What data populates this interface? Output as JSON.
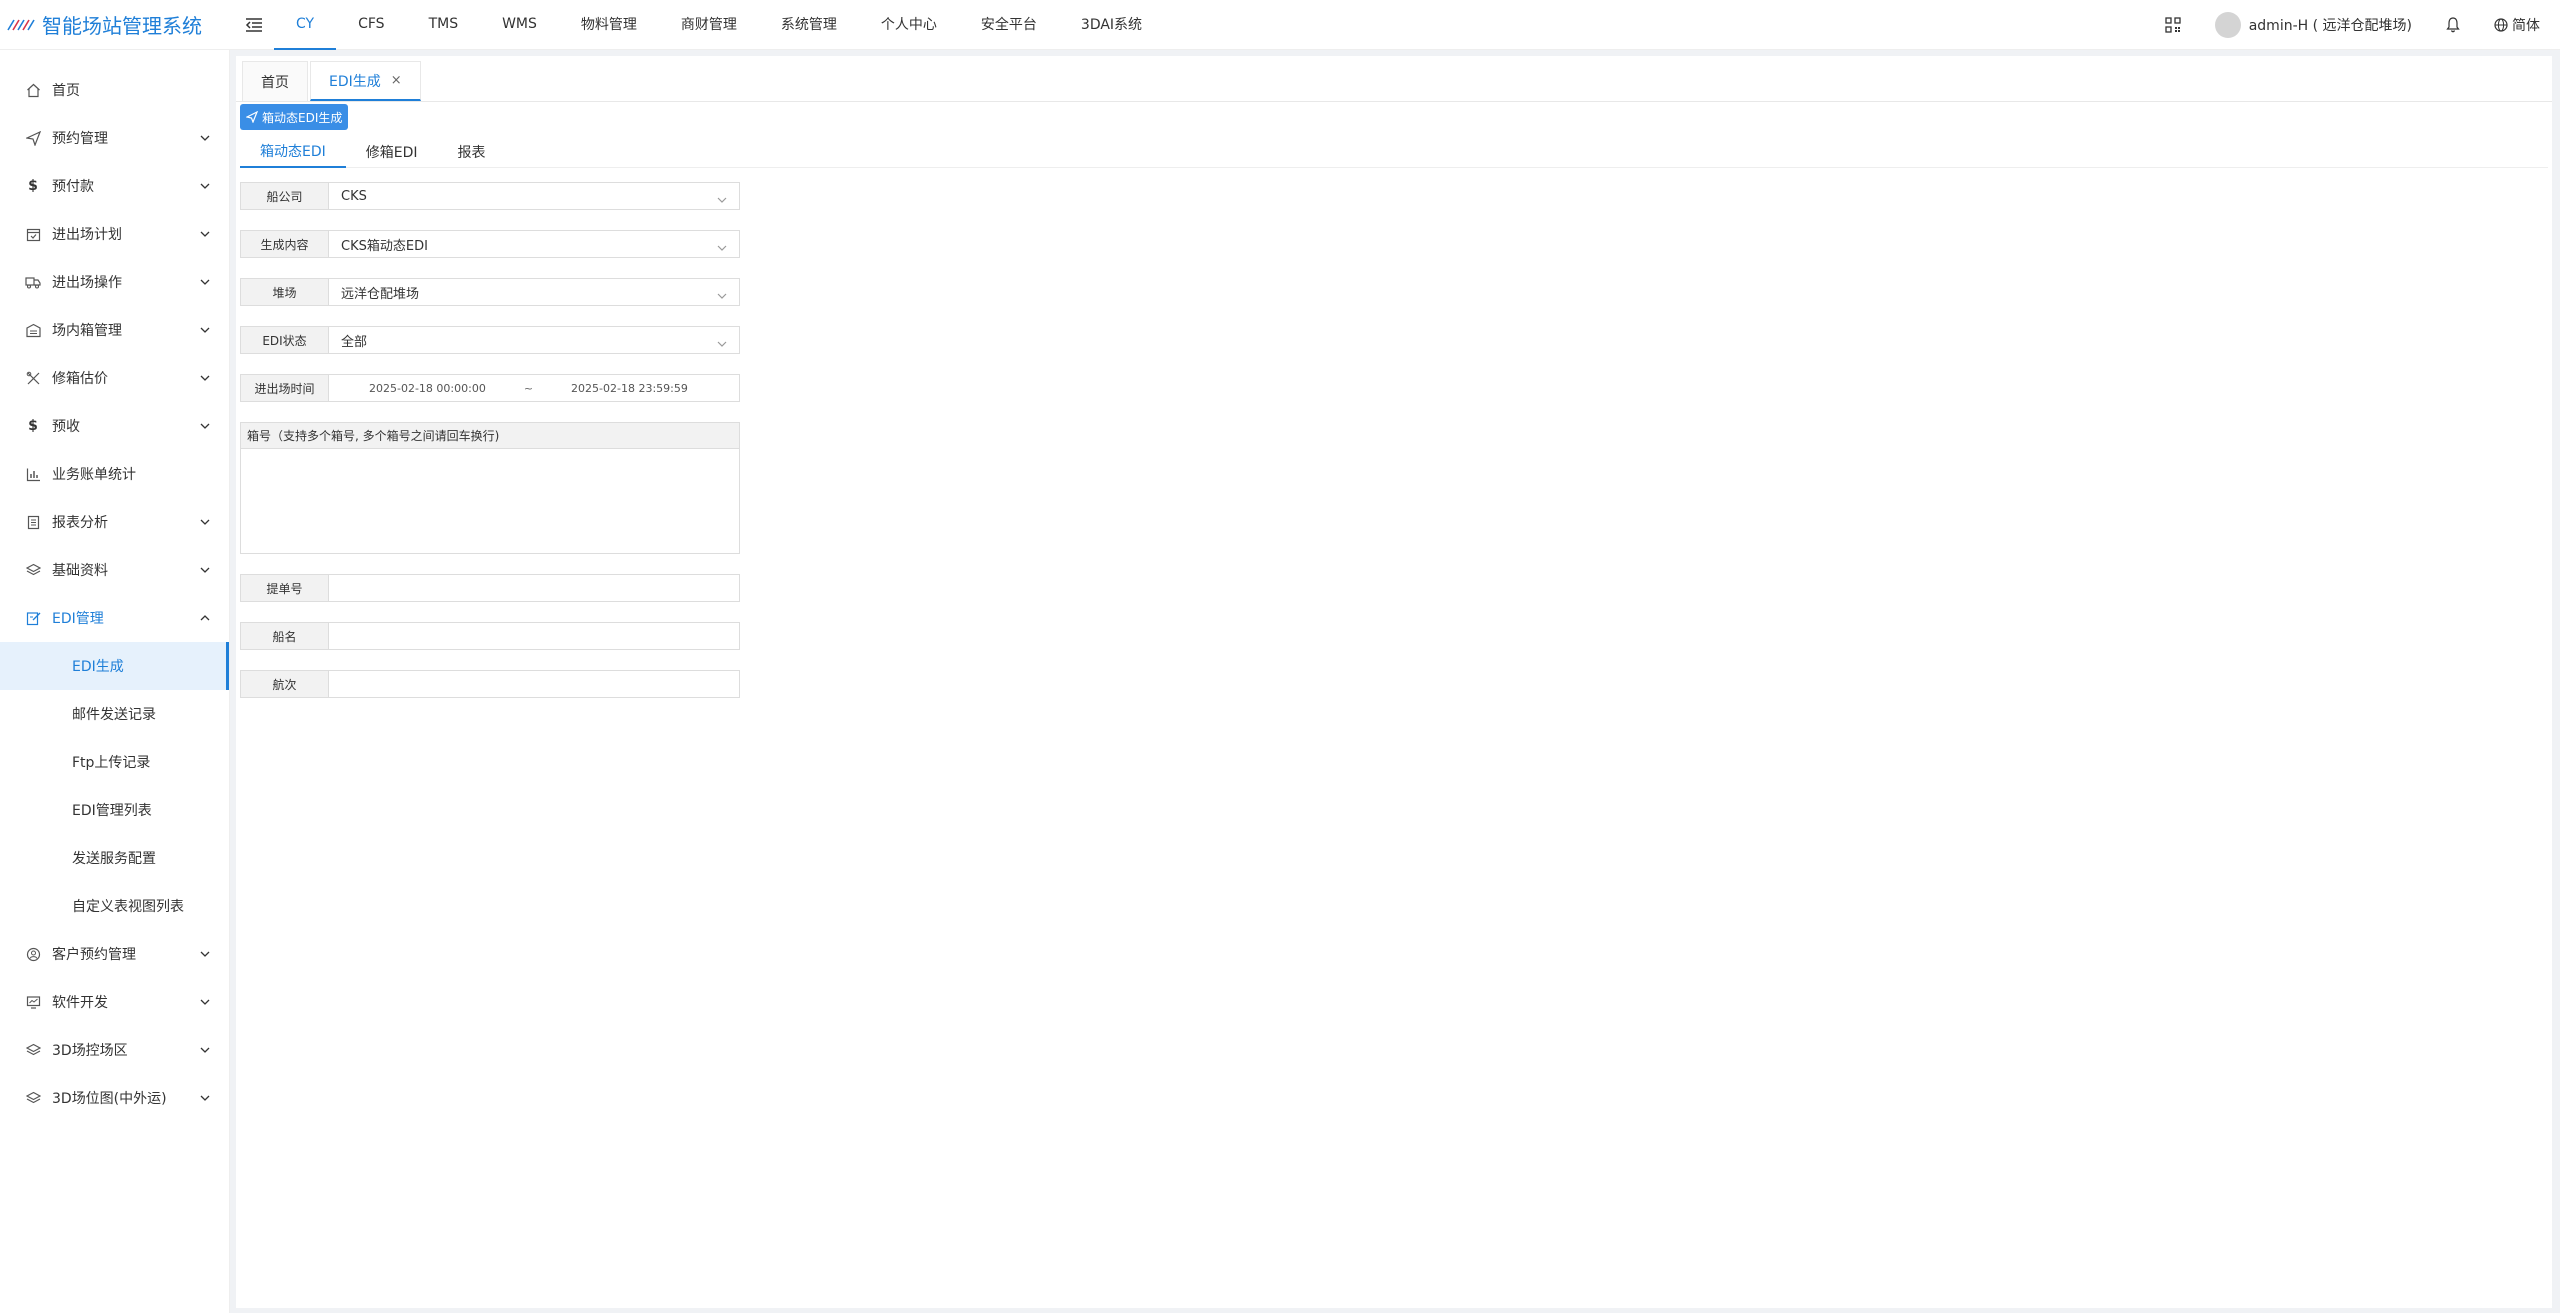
{
  "app": {
    "title": "智能场站管理系统"
  },
  "topnav": {
    "items": [
      {
        "label": "CY",
        "active": true
      },
      {
        "label": "CFS"
      },
      {
        "label": "TMS"
      },
      {
        "label": "WMS"
      },
      {
        "label": "物料管理"
      },
      {
        "label": "商财管理"
      },
      {
        "label": "系统管理"
      },
      {
        "label": "个人中心"
      },
      {
        "label": "安全平台"
      },
      {
        "label": "3DAI系统"
      }
    ]
  },
  "topright": {
    "user": "admin-H ( 远洋仓配堆场)",
    "language": "简体"
  },
  "sidebar": {
    "items": [
      {
        "label": "首页",
        "icon": "home-icon"
      },
      {
        "label": "预约管理",
        "icon": "send-icon",
        "expand": true
      },
      {
        "label": "预付款",
        "icon": "dollar-icon",
        "expand": true
      },
      {
        "label": "进出场计划",
        "icon": "calendar-icon",
        "expand": true
      },
      {
        "label": "进出场操作",
        "icon": "truck-icon",
        "expand": true
      },
      {
        "label": "场内箱管理",
        "icon": "warehouse-icon",
        "expand": true
      },
      {
        "label": "修箱估价",
        "icon": "tools-icon",
        "expand": true
      },
      {
        "label": "预收",
        "icon": "dollar-icon",
        "expand": true
      },
      {
        "label": "业务账单统计",
        "icon": "bar-chart-icon"
      },
      {
        "label": "报表分析",
        "icon": "report-icon",
        "expand": true
      },
      {
        "label": "基础资料",
        "icon": "layers-icon",
        "expand": true
      },
      {
        "label": "EDI管理",
        "icon": "edit-doc-icon",
        "open": true
      }
    ],
    "sub_items": [
      {
        "label": "EDI生成",
        "active": true
      },
      {
        "label": "邮件发送记录"
      },
      {
        "label": "Ftp上传记录"
      },
      {
        "label": "EDI管理列表"
      },
      {
        "label": "发送服务配置"
      },
      {
        "label": "自定义表视图列表"
      }
    ],
    "items_after": [
      {
        "label": "客户预约管理",
        "icon": "customer-icon"
      },
      {
        "label": "软件开发",
        "icon": "monitor-icon"
      },
      {
        "label": "3D场控场区",
        "icon": "layers-icon"
      },
      {
        "label": "3D场位图(中外运)",
        "icon": "layers-icon"
      }
    ]
  },
  "tabs": [
    {
      "label": "首页"
    },
    {
      "label": "EDI生成",
      "active": true,
      "closable": true
    }
  ],
  "action_button": "箱动态EDI生成",
  "sub_tabs": [
    {
      "label": "箱动态EDI",
      "active": true
    },
    {
      "label": "修箱EDI"
    },
    {
      "label": "报表"
    }
  ],
  "form": {
    "shipping_company": {
      "label": "船公司",
      "value": "CKS"
    },
    "content": {
      "label": "生成内容",
      "value": "CKS箱动态EDI"
    },
    "yard": {
      "label": "堆场",
      "value": "远洋仓配堆场"
    },
    "edi_status": {
      "label": "EDI状态",
      "value": "全部"
    },
    "time": {
      "label": "进出场时间",
      "start": "2025-02-18 00:00:00",
      "sep": "~",
      "end": "2025-02-18 23:59:59"
    },
    "container_no": {
      "label": "箱号（支持多个箱号, 多个箱号之间请回车换行)",
      "value": ""
    },
    "bill_no": {
      "label": "提单号",
      "value": ""
    },
    "vessel": {
      "label": "船名",
      "value": ""
    },
    "voyage": {
      "label": "航次",
      "value": ""
    }
  }
}
